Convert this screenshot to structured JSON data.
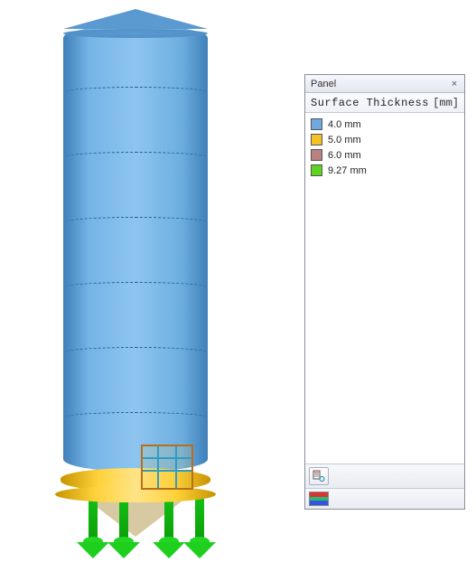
{
  "panel": {
    "title": "Panel",
    "header_label": "Surface Thickness",
    "header_unit": "[mm]"
  },
  "legend": [
    {
      "color": "#6fa9e0",
      "label": "4.0 mm"
    },
    {
      "color": "#f4c227",
      "label": "5.0 mm"
    },
    {
      "color": "#b98181",
      "label": "6.0 mm"
    },
    {
      "color": "#5fd321",
      "label": "9.27 mm"
    }
  ],
  "model": {
    "object": "silo",
    "barrel_color": "#6fa9e0",
    "collar_color": "#f4c227",
    "hopper_color": "#d7c9a1",
    "support_color": "#1ecf1e"
  }
}
